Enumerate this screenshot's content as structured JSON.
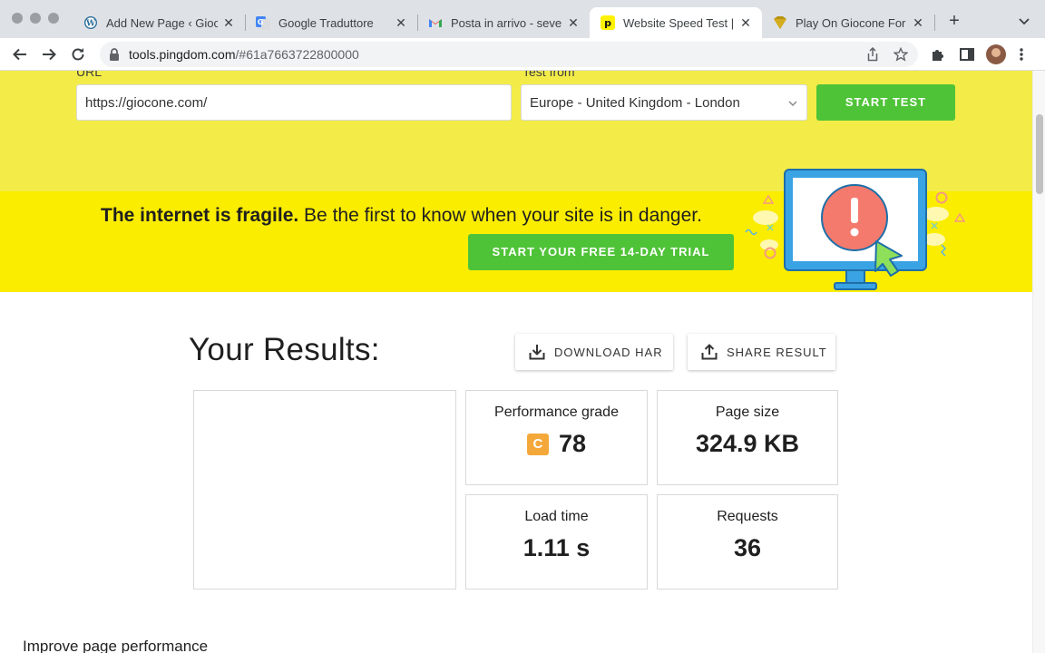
{
  "browser": {
    "tabs": [
      {
        "title": "Add New Page ‹ Gioco",
        "icon": "wordpress-icon"
      },
      {
        "title": "Google Traduttore",
        "icon": "google-translate-icon"
      },
      {
        "title": "Posta in arrivo - seven",
        "icon": "gmail-icon"
      },
      {
        "title": "Website Speed Test | P",
        "icon": "pingdom-icon",
        "active": true
      },
      {
        "title": "Play On Giocone For F",
        "icon": "giocone-icon"
      }
    ],
    "url_host": "tools.pingdom.com",
    "url_path": "/#61a7663722800000"
  },
  "form": {
    "url_label": "URL",
    "url_value": "https://giocone.com/",
    "test_from_label": "Test from",
    "region": "Europe - United Kingdom - London",
    "start_button": "START TEST"
  },
  "banner": {
    "bold_text": "The internet is fragile.",
    "text": " Be the first to know when your site is in danger.",
    "trial_button": "START YOUR FREE 14-DAY TRIAL"
  },
  "results": {
    "title": "Your Results:",
    "download_label": "DOWNLOAD HAR",
    "share_label": "SHARE RESULT",
    "performance_label": "Performance grade",
    "grade_letter": "C",
    "grade_value": "78",
    "page_size_label": "Page size",
    "page_size_value": "324.9 KB",
    "load_time_label": "Load time",
    "load_time_value": "1.11 s",
    "requests_label": "Requests",
    "requests_value": "36"
  },
  "next_section_heading": "Improve page performance",
  "colors": {
    "form_band": "#f3ec48",
    "banner": "#fbed00",
    "green_button": "#4fc338",
    "grade_badge": "#f5a83a"
  }
}
